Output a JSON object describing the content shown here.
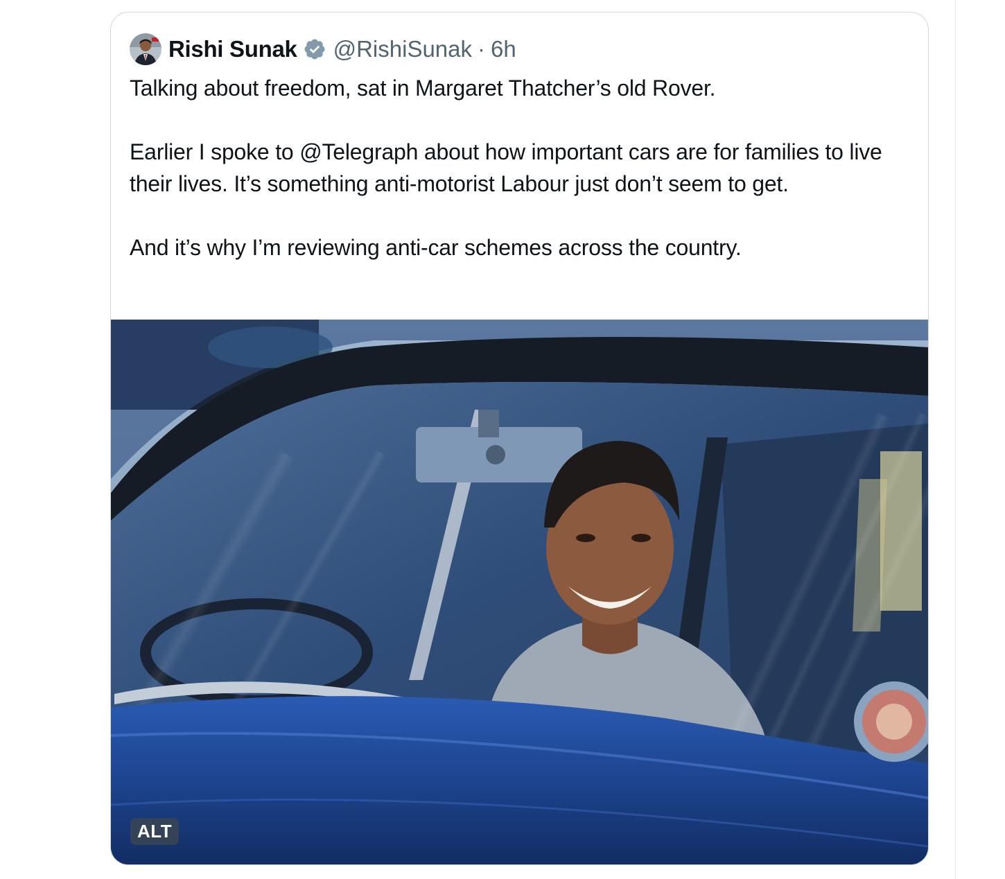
{
  "tweet": {
    "author": {
      "display_name": "Rishi Sunak",
      "handle": "@RishiSunak",
      "verified": true,
      "avatar_icon": "profile-photo"
    },
    "separator": "·",
    "timestamp": "6h",
    "text_paragraphs": [
      "Talking about freedom, sat in Margaret Thatcher’s old Rover.",
      "Earlier I spoke to @Telegraph about how important cars are for families to live their lives. It’s something anti-motorist Labour just don’t seem to get.",
      "And it’s why I’m reviewing anti-car schemes across the country."
    ],
    "media": {
      "type": "photo",
      "alt_label": "ALT"
    }
  },
  "colors": {
    "text_primary": "#0f1419",
    "text_secondary": "#536471",
    "verified_badge": "#829aab",
    "card_border": "#cfd9de",
    "car_blue": "#1f4a9a"
  }
}
